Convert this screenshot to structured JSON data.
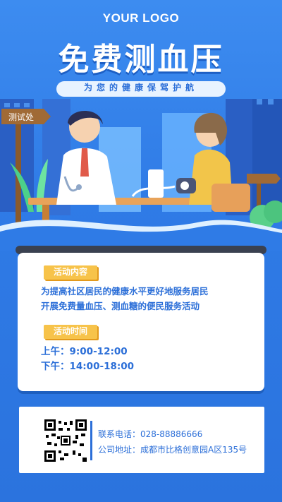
{
  "logo": "YOUR LOGO",
  "title": "免费测血压",
  "subtitle": "为您的健康保驾护航",
  "sign": "测试处",
  "activity": {
    "content_tag": "活动内容",
    "content_lines": [
      "为提高社区居民的健康水平更好地服务居民",
      "开展免费量血压、测血糖的便民服务活动"
    ],
    "time_tag": "活动时间",
    "time_lines": [
      "上午：9:00-12:00",
      "下午：14:00-18:00"
    ]
  },
  "contact": {
    "phone": "联系电话：028-88886666",
    "address": "公司地址：成都市比格创意园A区135号"
  },
  "colors": {
    "primary": "#2c6fd8",
    "accent": "#f7c34a",
    "background": "#2f7be6"
  }
}
